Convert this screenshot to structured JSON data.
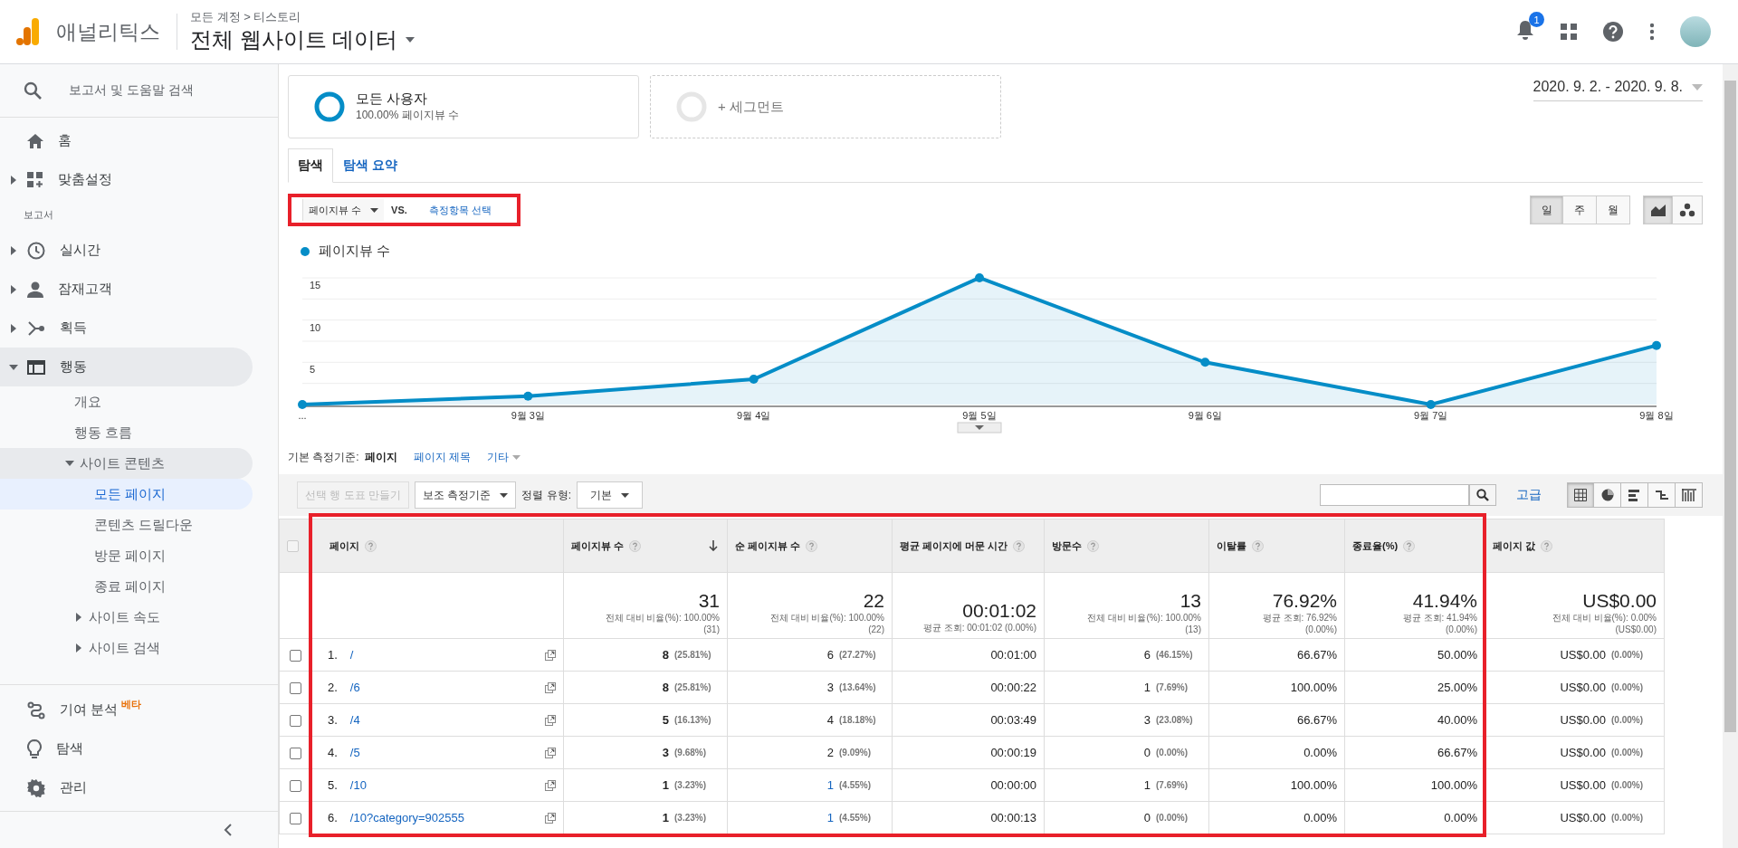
{
  "header": {
    "product": "애널리틱스",
    "breadcrumb": "모든 계정 > 티스토리",
    "view": "전체 웹사이트 데이터",
    "notifications": "1"
  },
  "sidebar": {
    "search": "보고서 및 도움말 검색",
    "top": [
      {
        "label": "홈",
        "selected": false
      },
      {
        "label": "맞춤설정",
        "expanded": false,
        "selected": false
      }
    ],
    "section": "보고서",
    "reports": [
      {
        "label": "실시간",
        "expanded": false,
        "selected": false
      },
      {
        "label": "잠재고객",
        "expanded": false,
        "selected": false
      },
      {
        "label": "획득",
        "expanded": false,
        "selected": false
      },
      {
        "label": "행동",
        "expanded": true,
        "selected": true,
        "children": [
          {
            "label": "개요",
            "selected": false
          },
          {
            "label": "행동 흐름",
            "selected": false
          },
          {
            "label": "사이트 콘텐츠",
            "expanded": true,
            "selected": false,
            "children": [
              {
                "label": "모든 페이지",
                "selected": true
              },
              {
                "label": "콘텐츠 드릴다운",
                "selected": false
              },
              {
                "label": "방문 페이지",
                "selected": false
              },
              {
                "label": "종료 페이지",
                "selected": false
              }
            ]
          },
          {
            "label": "사이트 속도",
            "expanded": false,
            "selected": false
          },
          {
            "label": "사이트 검색",
            "expanded": false,
            "selected": false
          }
        ]
      }
    ],
    "bottom": [
      {
        "label": "기여 분석",
        "badge": "베타",
        "selected": false
      },
      {
        "label": "탐색",
        "selected": false
      },
      {
        "label": "관리",
        "selected": false
      }
    ]
  },
  "segments": [
    {
      "title": "모든 사용자",
      "subtitle": "100.00% 페이지뷰 수",
      "active": true
    },
    {
      "title": "+ 세그먼트",
      "active": false
    }
  ],
  "date_range": "2020. 9. 2. - 2020. 9. 8.",
  "tabs": [
    {
      "label": "탐색",
      "selected": true
    },
    {
      "label": "탐색 요약",
      "selected": false
    }
  ],
  "metric": {
    "primary": "페이지뷰 수",
    "vs": "VS.",
    "secondary": "측정항목 선택"
  },
  "granularity": [
    {
      "label": "일",
      "selected": true
    },
    {
      "label": "주",
      "selected": false
    },
    {
      "label": "월",
      "selected": false
    }
  ],
  "chart_modes": [
    {
      "kind": "line",
      "selected": true
    },
    {
      "kind": "scatter",
      "selected": false
    }
  ],
  "chart": {
    "chart_data": {
      "type": "line",
      "categories": [
        "...",
        "9월 3일",
        "9월 4일",
        "9월 5일",
        "9월 6일",
        "9월 7일",
        "9월 8일"
      ],
      "series": [
        {
          "name": "페이지뷰 수",
          "color": "#058dc7",
          "marker": "circle",
          "values": [
            0,
            1,
            3,
            15,
            5,
            0,
            7
          ]
        }
      ],
      "ylim": [
        0,
        15
      ],
      "yticks": [
        5,
        10,
        15
      ]
    }
  },
  "dimensions": {
    "label": "기본 측정기준:",
    "items": [
      {
        "label": "페이지",
        "selected": true
      },
      {
        "label": "페이지 제목",
        "selected": false
      },
      {
        "label": "기타",
        "selected": false
      }
    ]
  },
  "toolbar": {
    "plot_rows": "선택 행 도표 만들기",
    "plot_disabled": true,
    "secondary": "보조 측정기준",
    "sort_label": "정렬 유형:",
    "sort": "기본",
    "advanced": "고급",
    "views": [
      {
        "kind": "table",
        "selected": true
      },
      {
        "kind": "pie",
        "selected": false
      },
      {
        "kind": "bar",
        "selected": false
      },
      {
        "kind": "compare",
        "selected": false
      },
      {
        "kind": "pivot",
        "selected": false
      }
    ]
  },
  "table": {
    "select_all_disabled": true,
    "columns": [
      {
        "label": "페이지",
        "sorted": false
      },
      {
        "label": "페이지뷰 수",
        "sorted": true
      },
      {
        "label": "순 페이지뷰 수",
        "sorted": false
      },
      {
        "label": "평균 페이지에 머문 시간",
        "sorted": false
      },
      {
        "label": "방문수",
        "sorted": false
      },
      {
        "label": "이탈률",
        "sorted": false
      },
      {
        "label": "종료율(%)",
        "sorted": false
      },
      {
        "label": "페이지 값",
        "sorted": false
      }
    ],
    "totals": [
      {
        "value": "31",
        "notes": [
          "전체 대비 비율(%): 100.00%",
          "(31)"
        ]
      },
      {
        "value": "22",
        "notes": [
          "전체 대비 비율(%): 100.00%",
          "(22)"
        ]
      },
      {
        "value": "00:01:02",
        "notes": [
          "평균 조회: 00:01:02 (0.00%)"
        ]
      },
      {
        "value": "13",
        "notes": [
          "전체 대비 비율(%): 100.00%",
          "(13)"
        ]
      },
      {
        "value": "76.92%",
        "notes": [
          "평균 조회: 76.92%",
          "(0.00%)"
        ]
      },
      {
        "value": "41.94%",
        "notes": [
          "평균 조회: 41.94%",
          "(0.00%)"
        ]
      },
      {
        "value": "US$0.00",
        "notes": [
          "전체 대비 비율(%): 0.00%",
          "(US$0.00)"
        ]
      }
    ],
    "rows": [
      {
        "checked": false,
        "cells": [
          {
            "index": "1.",
            "value": "/"
          },
          {
            "value": "8",
            "pct": "(25.81%)"
          },
          {
            "value": "6",
            "pct": "(27.27%)"
          },
          {
            "value": "00:01:00"
          },
          {
            "value": "6",
            "pct": "(46.15%)"
          },
          {
            "value": "66.67%"
          },
          {
            "value": "50.00%"
          },
          {
            "value": "US$0.00",
            "pct": "(0.00%)"
          }
        ]
      },
      {
        "checked": false,
        "cells": [
          {
            "index": "2.",
            "value": "/6"
          },
          {
            "value": "8",
            "pct": "(25.81%)"
          },
          {
            "value": "3",
            "pct": "(13.64%)"
          },
          {
            "value": "00:00:22"
          },
          {
            "value": "1",
            "pct": "(7.69%)"
          },
          {
            "value": "100.00%"
          },
          {
            "value": "25.00%"
          },
          {
            "value": "US$0.00",
            "pct": "(0.00%)"
          }
        ]
      },
      {
        "checked": false,
        "cells": [
          {
            "index": "3.",
            "value": "/4"
          },
          {
            "value": "5",
            "pct": "(16.13%)"
          },
          {
            "value": "4",
            "pct": "(18.18%)"
          },
          {
            "value": "00:03:49"
          },
          {
            "value": "3",
            "pct": "(23.08%)"
          },
          {
            "value": "66.67%"
          },
          {
            "value": "40.00%"
          },
          {
            "value": "US$0.00",
            "pct": "(0.00%)"
          }
        ]
      },
      {
        "checked": false,
        "cells": [
          {
            "index": "4.",
            "value": "/5"
          },
          {
            "value": "3",
            "pct": "(9.68%)"
          },
          {
            "value": "2",
            "pct": "(9.09%)"
          },
          {
            "value": "00:00:19"
          },
          {
            "value": "0",
            "pct": "(0.00%)"
          },
          {
            "value": "0.00%"
          },
          {
            "value": "66.67%"
          },
          {
            "value": "US$0.00",
            "pct": "(0.00%)"
          }
        ]
      },
      {
        "checked": false,
        "cells": [
          {
            "index": "5.",
            "value": "/10"
          },
          {
            "value": "1",
            "pct": "(3.23%)"
          },
          {
            "value": "1",
            "pct": "(4.55%)",
            "link": true
          },
          {
            "value": "00:00:00"
          },
          {
            "value": "1",
            "pct": "(7.69%)"
          },
          {
            "value": "100.00%"
          },
          {
            "value": "100.00%"
          },
          {
            "value": "US$0.00",
            "pct": "(0.00%)"
          }
        ]
      },
      {
        "checked": false,
        "cells": [
          {
            "index": "6.",
            "value": "/10?category=902555"
          },
          {
            "value": "1",
            "pct": "(3.23%)"
          },
          {
            "value": "1",
            "pct": "(4.55%)",
            "link": true
          },
          {
            "value": "00:00:13"
          },
          {
            "value": "0",
            "pct": "(0.00%)"
          },
          {
            "value": "0.00%"
          },
          {
            "value": "0.00%"
          },
          {
            "value": "US$0.00",
            "pct": "(0.00%)"
          }
        ]
      }
    ]
  }
}
